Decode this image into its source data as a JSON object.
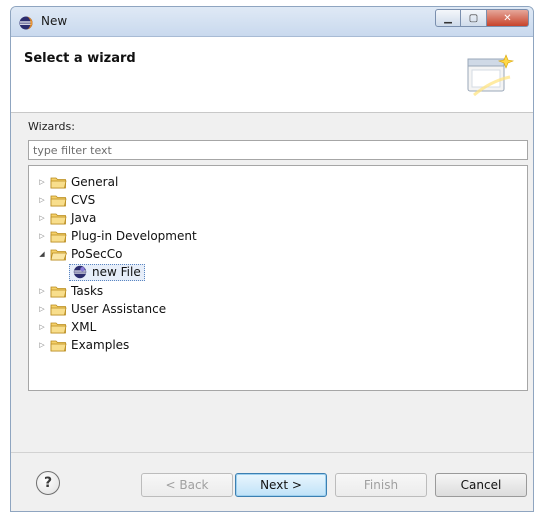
{
  "window": {
    "title": "New",
    "icon": "eclipse-icon"
  },
  "header": {
    "title": "Select a wizard",
    "image_icon": "wizard-banner-icon"
  },
  "filter": {
    "label": "Wizards:",
    "placeholder": "type filter text",
    "value": ""
  },
  "tree": {
    "items": [
      {
        "label": "General",
        "expanded": false
      },
      {
        "label": "CVS",
        "expanded": false
      },
      {
        "label": "Java",
        "expanded": false
      },
      {
        "label": "Plug-in Development",
        "expanded": false
      },
      {
        "label": "PoSecCo",
        "expanded": true,
        "children": [
          {
            "label": "new File",
            "selected": true
          }
        ]
      },
      {
        "label": "Tasks",
        "expanded": false
      },
      {
        "label": "User Assistance",
        "expanded": false
      },
      {
        "label": "XML",
        "expanded": false
      },
      {
        "label": "Examples",
        "expanded": false
      }
    ]
  },
  "buttons": {
    "help": "?",
    "back": "< Back",
    "next": "Next >",
    "finish": "Finish",
    "cancel": "Cancel"
  },
  "colors": {
    "folder": "#f2c64f",
    "selection": "#e7eef9",
    "default_button_border": "#3c7fb1"
  }
}
